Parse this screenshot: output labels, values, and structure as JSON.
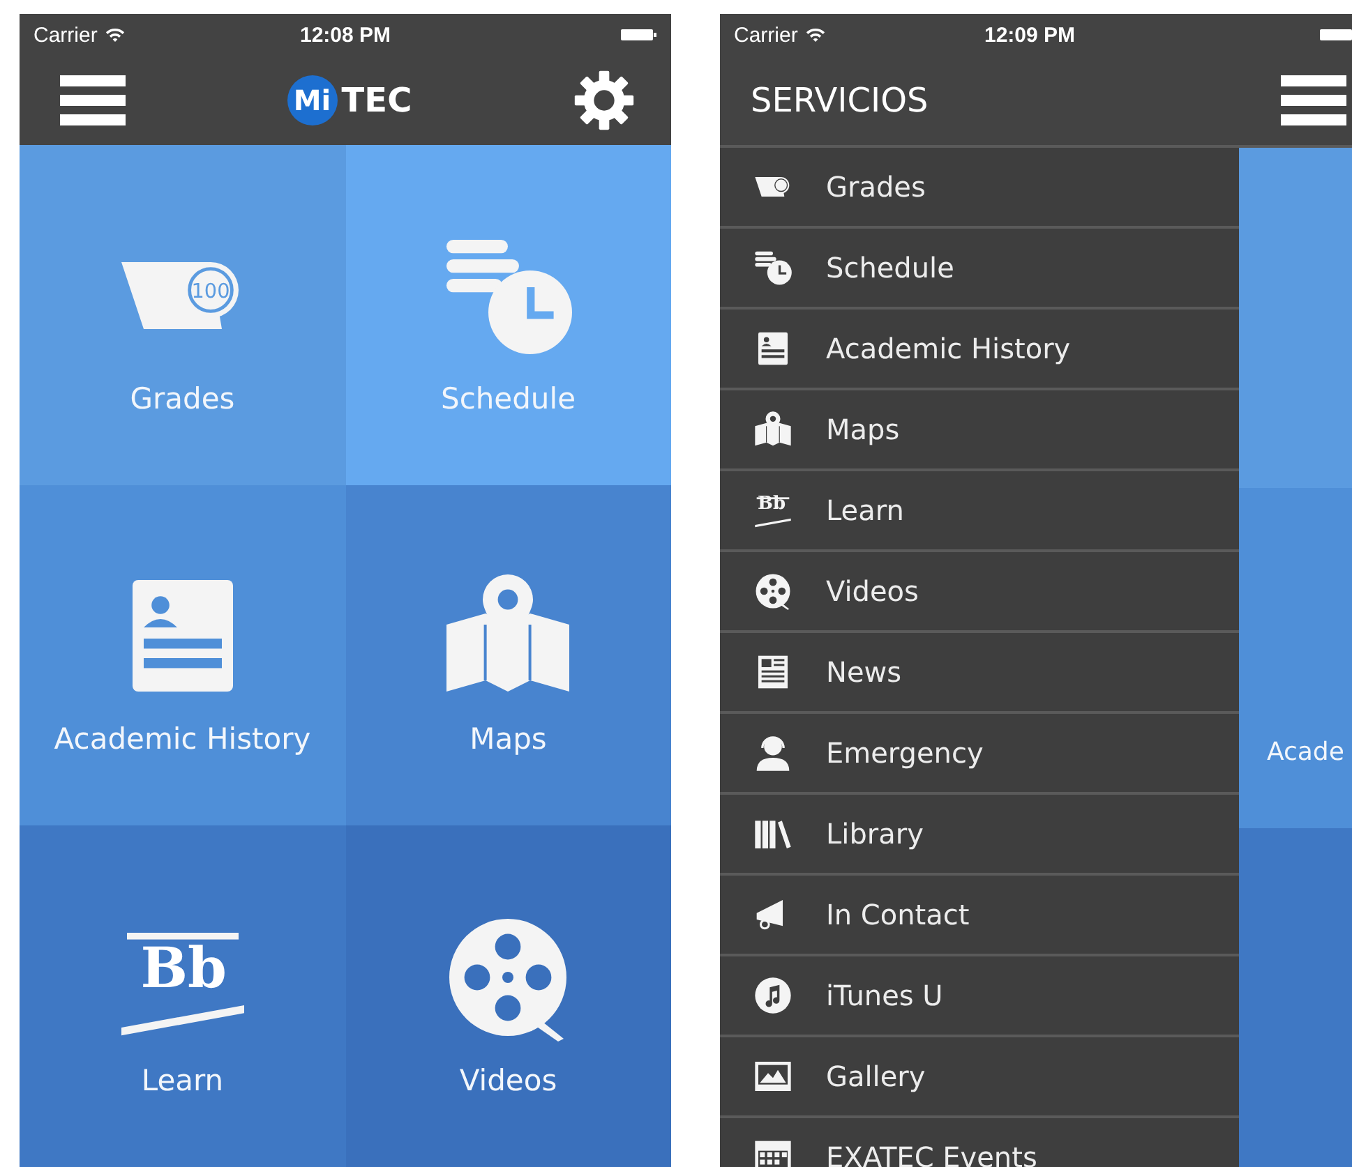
{
  "screens": [
    {
      "status_bar": {
        "carrier": "Carrier",
        "time": "12:08 PM"
      },
      "header": {
        "logo_badge": "Mi",
        "logo_text": "TEC"
      },
      "tiles": [
        {
          "label": "Grades",
          "badge": "100"
        },
        {
          "label": "Schedule"
        },
        {
          "label": "Academic History"
        },
        {
          "label": "Maps"
        },
        {
          "label": "Learn",
          "logo": "Bb"
        },
        {
          "label": "Videos"
        }
      ]
    },
    {
      "status_bar": {
        "carrier": "Carrier",
        "time": "12:09 PM"
      },
      "header": {
        "title": "SERVICIOS"
      },
      "menu": [
        {
          "label": "Grades"
        },
        {
          "label": "Schedule"
        },
        {
          "label": "Academic History"
        },
        {
          "label": "Maps"
        },
        {
          "label": "Learn",
          "logo": "Bb"
        },
        {
          "label": "Videos"
        },
        {
          "label": "News"
        },
        {
          "label": "Emergency"
        },
        {
          "label": "Library"
        },
        {
          "label": "In Contact"
        },
        {
          "label": "iTunes U"
        },
        {
          "label": "Gallery"
        },
        {
          "label": "EXATEC Events"
        }
      ],
      "peek_label": "Acade"
    }
  ]
}
